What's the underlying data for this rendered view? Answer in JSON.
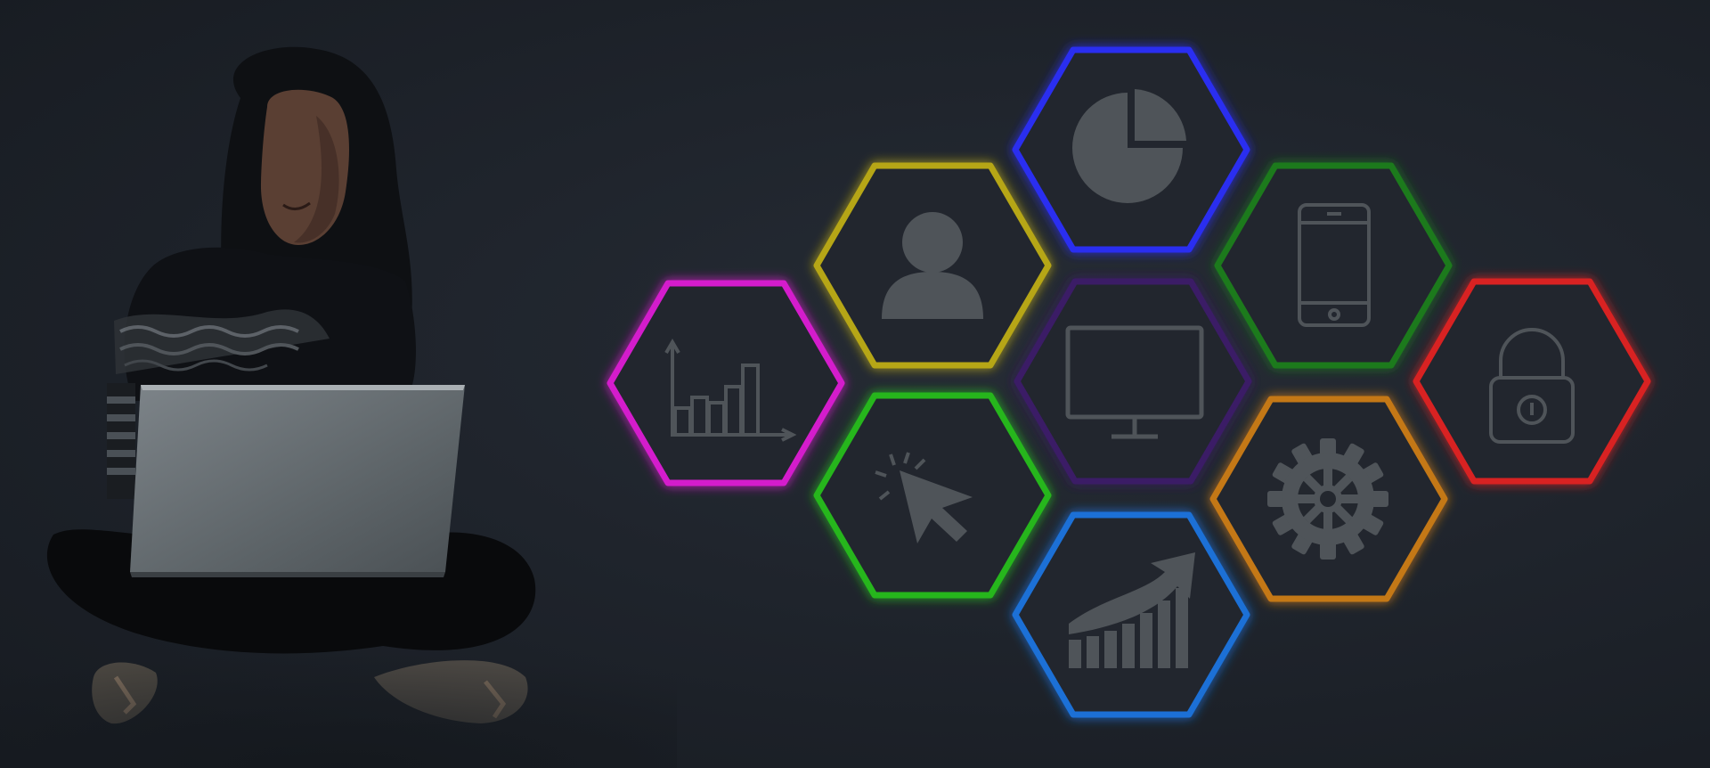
{
  "scene": {
    "background": "#1f242c",
    "icon_color": "#4f5459"
  },
  "hexagons": [
    {
      "name": "chart-bars",
      "icon": "bar-chart-icon",
      "color": "#d41fcc"
    },
    {
      "name": "user",
      "icon": "user-icon",
      "color": "#b6a617"
    },
    {
      "name": "pie",
      "icon": "pie-chart-icon",
      "color": "#2a2ef0"
    },
    {
      "name": "mobile",
      "icon": "smartphone-icon",
      "color": "#1f7a1f"
    },
    {
      "name": "lock",
      "icon": "lock-icon",
      "color": "#d82020"
    },
    {
      "name": "monitor",
      "icon": "monitor-icon",
      "color": "#3a1a66"
    },
    {
      "name": "cursor",
      "icon": "cursor-click-icon",
      "color": "#26b61e"
    },
    {
      "name": "gear",
      "icon": "gear-icon",
      "color": "#c47818"
    },
    {
      "name": "growth",
      "icon": "growth-arrow-icon",
      "color": "#1a6fd6"
    }
  ],
  "person": {
    "description_icon": "woman-with-laptop"
  }
}
